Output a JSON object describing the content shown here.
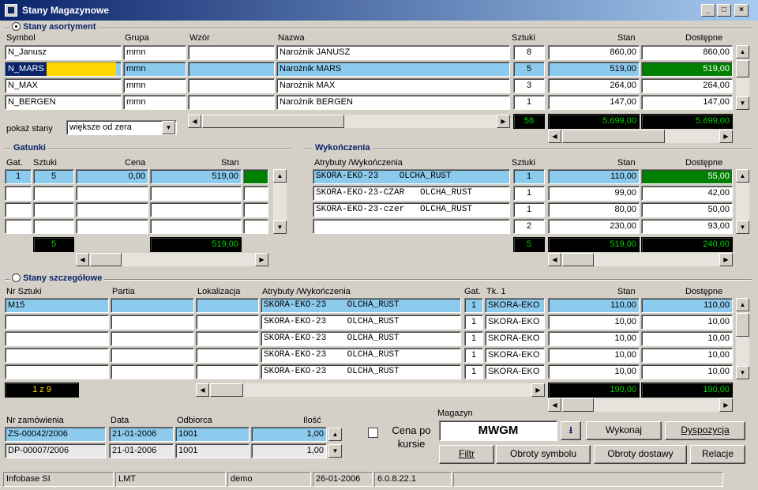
{
  "window": {
    "title": "Stany Magazynowe",
    "min": "_",
    "max": "□",
    "close": "×"
  },
  "asort": {
    "section": "Stany asortyment",
    "headers": {
      "symbol": "Symbol",
      "grupa": "Grupa",
      "wzor": "Wzór",
      "nazwa": "Nazwa",
      "sztuki": "Sztuki",
      "stan": "Stan",
      "dostepne": "Dostępne"
    },
    "rows": [
      {
        "symbol": "N_Janusz",
        "grupa": "mmn",
        "wzor": "",
        "nazwa": "Narożnik JANUSZ",
        "sztuki": "8",
        "stan": "860,00",
        "dostepne": "860,00"
      },
      {
        "symbol": "N_MARS",
        "grupa": "mmn",
        "wzor": "",
        "nazwa": "Narożnik MARS",
        "sztuki": "5",
        "stan": "519,00",
        "dostepne": "519,00"
      },
      {
        "symbol": "N_MAX",
        "grupa": "mmn",
        "wzor": "",
        "nazwa": "Narożnik MAX",
        "sztuki": "3",
        "stan": "264,00",
        "dostepne": "264,00"
      },
      {
        "symbol": "N_BERGEN",
        "grupa": "mmn",
        "wzor": "",
        "nazwa": "Narożnik BERGEN",
        "sztuki": "1",
        "stan": "147,00",
        "dostepne": "147,00"
      }
    ],
    "totals": {
      "sztuki": "58",
      "stan": "5.699,00",
      "dostepne": "5.699,00"
    },
    "filter_label": "pokaż stany",
    "filter_value": "większe od zera"
  },
  "gatunki": {
    "section": "Gatunki",
    "headers": {
      "gat": "Gat.",
      "sztuki": "Sztuki",
      "cena": "Cena",
      "stan": "Stan"
    },
    "rows": [
      {
        "gat": "1",
        "sztuki": "5",
        "cena": "0,00",
        "stan": "519,00"
      }
    ],
    "totals": {
      "sztuki": "5",
      "stan": "519,00"
    }
  },
  "wyk": {
    "section": "Wykończenia",
    "headers": {
      "atr": "Atrybuty /Wykończenia",
      "sztuki": "Sztuki",
      "stan": "Stan",
      "dostepne": "Dostępne"
    },
    "rows": [
      {
        "atr": "SKORA-EKO-23    OLCHA_RUST",
        "sztuki": "1",
        "stan": "110,00",
        "dostepne": "55,00"
      },
      {
        "atr": "SKORA-EKO-23-CZAR   OLCHA_RUST",
        "sztuki": "1",
        "stan": "99,00",
        "dostepne": "42,00"
      },
      {
        "atr": "SKORA-EKO-23-czer   OLCHA_RUST",
        "sztuki": "1",
        "stan": "80,00",
        "dostepne": "50,00"
      },
      {
        "atr": "",
        "sztuki": "2",
        "stan": "230,00",
        "dostepne": "93,00"
      }
    ],
    "totals": {
      "sztuki": "5",
      "stan": "519,00",
      "dostepne": "240,00"
    }
  },
  "szcz": {
    "section": "Stany szczegółowe",
    "headers": {
      "nr": "Nr Sztuki",
      "partia": "Partia",
      "lok": "Lokalizacja",
      "atr": "Atrybuty /Wykończenia",
      "gat": "Gat.",
      "tk": "Tk. 1",
      "stan": "Stan",
      "dostepne": "Dostępne"
    },
    "rows": [
      {
        "nr": "M15",
        "partia": "",
        "lok": "",
        "atr": "SKORA-EKO-23    OLCHA_RUST",
        "gat": "1",
        "tk": "SKORA-EKO",
        "stan": "110,00",
        "dostepne": "110,00"
      },
      {
        "nr": "",
        "partia": "",
        "lok": "",
        "atr": "SKORA-EKO-23    OLCHA_RUST",
        "gat": "1",
        "tk": "SKORA-EKO",
        "stan": "10,00",
        "dostepne": "10,00"
      },
      {
        "nr": "",
        "partia": "",
        "lok": "",
        "atr": "SKORA-EKO-23    OLCHA_RUST",
        "gat": "1",
        "tk": "SKORA-EKO",
        "stan": "10,00",
        "dostepne": "10,00"
      },
      {
        "nr": "",
        "partia": "",
        "lok": "",
        "atr": "SKORA-EKO-23    OLCHA_RUST",
        "gat": "1",
        "tk": "SKORA-EKO",
        "stan": "10,00",
        "dostepne": "10,00"
      },
      {
        "nr": "",
        "partia": "",
        "lok": "",
        "atr": "SKORA-EKO-23    OLCHA_RUST",
        "gat": "1",
        "tk": "SKORA-EKO",
        "stan": "10,00",
        "dostepne": "10,00"
      }
    ],
    "counter": "1 z 9",
    "totals": {
      "stan": "190,00",
      "dostepne": "190,00"
    }
  },
  "orders": {
    "headers": {
      "nr": "Nr zamówienia",
      "data": "Data",
      "odb": "Odbiorca",
      "ilosc": "Ilość"
    },
    "rows": [
      {
        "nr": "ZS-00042/2006",
        "data": "21-01-2006",
        "odb": "1001",
        "ilosc": "1,00"
      },
      {
        "nr": "DP-00007/2006",
        "data": "21-01-2006",
        "odb": "1001",
        "ilosc": "1,00"
      }
    ]
  },
  "controls": {
    "cena_po_kursie": "Cena po kursie",
    "magazyn_label": "Magazyn",
    "magazyn_value": "MWGM",
    "wykonaj": "Wykonaj",
    "dyspozycja": "Dyspozycja",
    "filtr": "Filtr",
    "obroty_symbolu": "Obroty symbolu",
    "obroty_dostawy": "Obroty dostawy",
    "relacje": "Relacje"
  },
  "statusbar": [
    "Infobase SI",
    "LMT",
    "demo",
    "26-01-2006",
    "6.0.8.22.1",
    ""
  ]
}
